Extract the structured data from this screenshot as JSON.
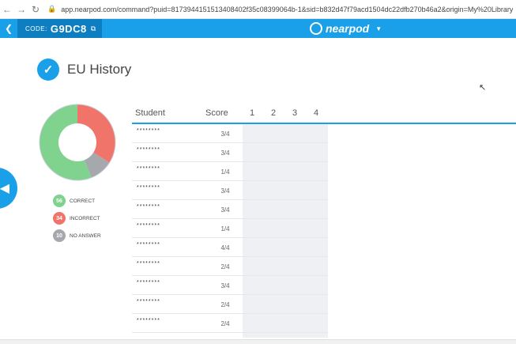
{
  "browser": {
    "back_glyph": "←",
    "forward_glyph": "→",
    "reload_glyph": "↻",
    "url": "app.nearpod.com/command?puid=8173944151513408402f35c08399064b-1&sid=b832d47f79acd1504dc22dfb270b46a2&origin=My%20Library"
  },
  "app": {
    "code_label": "CODE:",
    "code_value": "G9DC8",
    "brand": "nearpod"
  },
  "lesson": {
    "title": "EU History"
  },
  "summary": {
    "correct": {
      "value": "56",
      "label": "CORRECT",
      "color": "#7fd38f"
    },
    "incorrect": {
      "value": "34",
      "label": "INCORRECT",
      "color": "#f0746a"
    },
    "no_answer": {
      "value": "10",
      "label": "NO ANSWER",
      "color": "#a5a9ad"
    }
  },
  "chart_data": {
    "type": "pie",
    "categories": [
      "CORRECT",
      "INCORRECT",
      "NO ANSWER"
    ],
    "values": [
      56,
      34,
      10
    ],
    "colors": [
      "#7fd38f",
      "#f0746a",
      "#a5a9ad"
    ]
  },
  "table": {
    "headers": {
      "student": "Student",
      "score": "Score",
      "q1": "1",
      "q2": "2",
      "q3": "3",
      "q4": "4"
    },
    "rows": [
      {
        "student": "********",
        "score": "3/4"
      },
      {
        "student": "********",
        "score": "3/4"
      },
      {
        "student": "********",
        "score": "1/4"
      },
      {
        "student": "********",
        "score": "3/4"
      },
      {
        "student": "********",
        "score": "3/4"
      },
      {
        "student": "********",
        "score": "1/4"
      },
      {
        "student": "********",
        "score": "4/4"
      },
      {
        "student": "********",
        "score": "2/4"
      },
      {
        "student": "********",
        "score": "3/4"
      },
      {
        "student": "********",
        "score": "2/4"
      },
      {
        "student": "********",
        "score": "2/4"
      }
    ]
  }
}
